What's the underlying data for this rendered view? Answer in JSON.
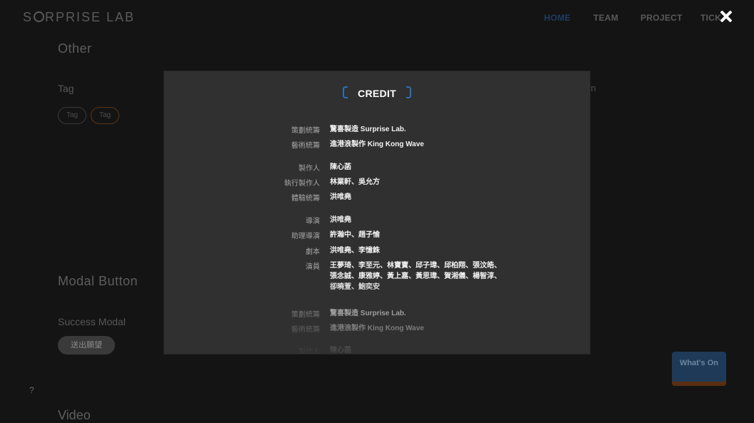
{
  "header": {
    "logo": "SURPRISE LAB",
    "logo_pre": "S",
    "logo_post": "RPRISE LAB",
    "nav": [
      "HOME",
      "TEAM",
      "PROJECT",
      "TICK"
    ]
  },
  "page": {
    "other_title": "Other",
    "tag_label": "Tag",
    "tags": [
      "Tag",
      "Tag"
    ],
    "modal_button_title": "Modal Button",
    "success_modal_label": "Success Modal",
    "send_button": "送出願望",
    "side_text": "wn",
    "help": "?",
    "whats_on": "What's On",
    "video_title": "Video"
  },
  "modal": {
    "title": "CREDIT",
    "credits": [
      {
        "role": "策劃統籌",
        "names": "驚喜製造 Surprise Lab."
      },
      {
        "role": "藝術統籌",
        "names": "進港浪製作 King Kong Wave"
      },
      {
        "role": "製作人",
        "names": "陳心菡"
      },
      {
        "role": "執行製作人",
        "names": "林業軒、吳允方"
      },
      {
        "role": "體驗統籌",
        "names": "洪唯堯"
      },
      {
        "role": "導演",
        "names": "洪唯堯"
      },
      {
        "role": "助理導演",
        "names": "許瀚中、趙子愉"
      },
      {
        "role": "劇本",
        "names": "洪唯堯、李憶銖"
      },
      {
        "role": "演員",
        "names": "王夢琦、李至元、林寶寶、邱子瑋、邱柏翔、張汶皓、張念誠、康雅婷、黃上嘉、黃思瑋、賀湘儀、楊智淳、 卻曉萱、鮑奕安"
      },
      {
        "role": "策劃統籌",
        "names": "驚喜製造 Surprise Lab."
      },
      {
        "role": "藝術統籌",
        "names": "進港浪製作 King Kong Wave"
      },
      {
        "role": "製作人",
        "names": "陳心菡"
      }
    ]
  },
  "colors": {
    "accent": "#2c6fbd",
    "modal_bg": "#303030",
    "page_bg": "#141414"
  }
}
